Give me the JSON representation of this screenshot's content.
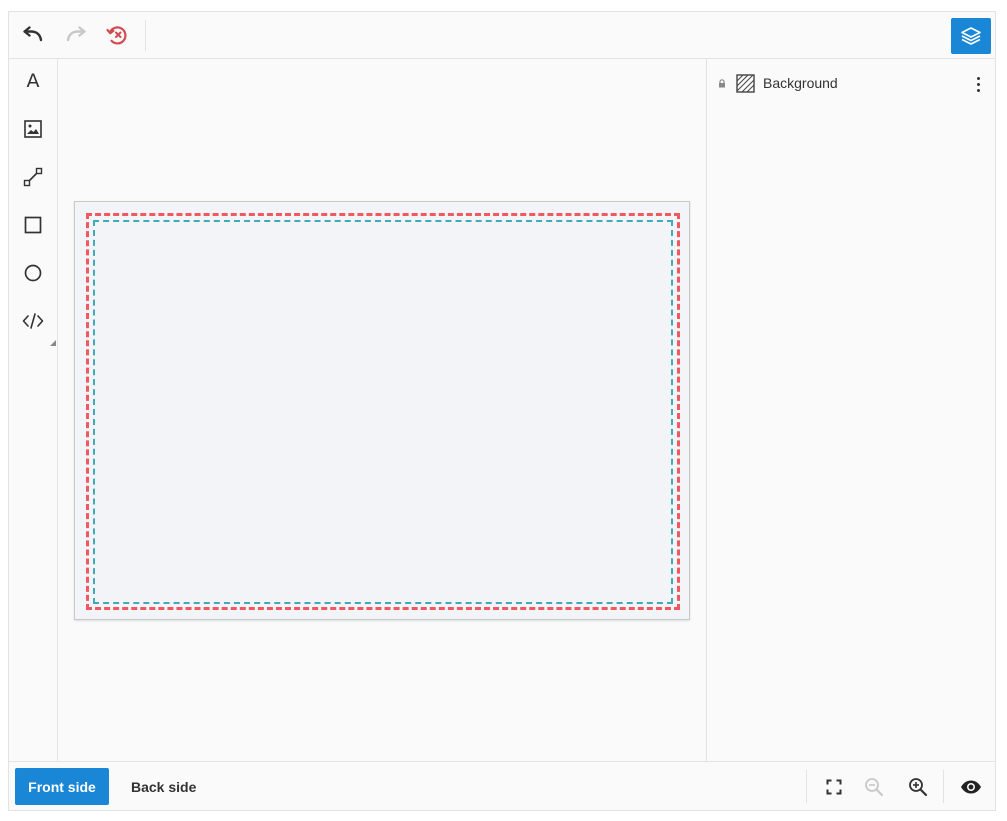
{
  "toolbar": {
    "undo_icon": "undo-icon",
    "redo_icon": "redo-icon",
    "reset_icon": "history-reset-icon",
    "layers_icon": "layers-icon",
    "colors": {
      "accent": "#1a86d6",
      "reset": "#d24b4f",
      "disabled": "#c8c8c8"
    }
  },
  "tools": [
    {
      "name": "text-tool",
      "label": "A"
    },
    {
      "name": "image-tool",
      "icon": "image-icon"
    },
    {
      "name": "line-tool",
      "icon": "line-icon"
    },
    {
      "name": "rectangle-tool",
      "icon": "square-icon"
    },
    {
      "name": "ellipse-tool",
      "icon": "circle-icon"
    },
    {
      "name": "code-tool",
      "icon": "code-icon"
    }
  ],
  "canvas": {
    "bleed_color": "#f0595f",
    "safe_color": "#40aab7",
    "background": "#f3f4f8"
  },
  "layers": {
    "items": [
      {
        "label": "Background",
        "locked": true,
        "icon": "background-layer-icon"
      }
    ]
  },
  "bottom": {
    "front_label": "Front side",
    "back_label": "Back side",
    "fullscreen_icon": "fullscreen-icon",
    "zoom_out_icon": "zoom-out-icon",
    "zoom_in_icon": "zoom-in-icon",
    "preview_icon": "eye-icon"
  }
}
